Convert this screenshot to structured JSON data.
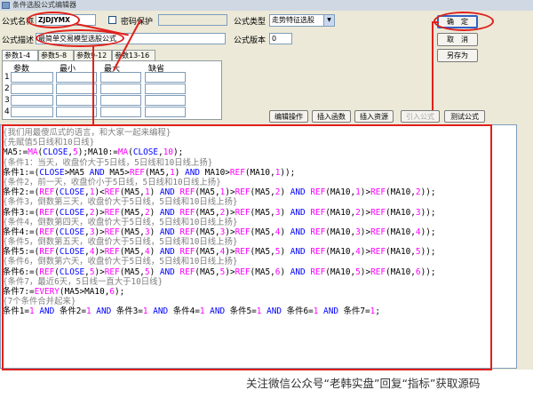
{
  "title_bar": {
    "title": "条件选股公式编辑器"
  },
  "form": {
    "name_label": "公式名称",
    "name_value": "ZJDJYMX",
    "password_label": "密码保护",
    "type_label": "公式类型",
    "type_value": "走势特征选股",
    "desc_label": "公式描述",
    "desc_value": "最简单交易模型选股公式",
    "version_label": "公式版本",
    "version_value": "0"
  },
  "buttons": {
    "ok": "确　定",
    "cancel": "取　消",
    "save_as": "另存为",
    "edit_ops": "编辑操作",
    "insert_func": "插入函数",
    "insert_res": "插入资源",
    "import": "引入公式",
    "test": "测试公式"
  },
  "param_tabs": [
    "参数1-4",
    "参数5-8",
    "参数9-12",
    "参数13-16"
  ],
  "param_table": {
    "headers": [
      "参数",
      "最小",
      "最大",
      "缺省"
    ],
    "rows": [
      "1",
      "2",
      "3",
      "4"
    ]
  },
  "code_lines": [
    [
      [
        "cm",
        "{我们用最傻瓜式的语言，和大家一起来编程}"
      ]
    ],
    [
      [
        "cm",
        "{先赋值5日线和10日线}"
      ]
    ],
    [
      [
        "t",
        "MA5:="
      ],
      [
        "fn",
        "MA"
      ],
      [
        "t",
        "("
      ],
      [
        "kw",
        "CLOSE"
      ],
      [
        "t",
        ","
      ],
      [
        "num",
        "5"
      ],
      [
        "t",
        ");MA10:="
      ],
      [
        "fn",
        "MA"
      ],
      [
        "t",
        "("
      ],
      [
        "kw",
        "CLOSE"
      ],
      [
        "t",
        ","
      ],
      [
        "num",
        "10"
      ],
      [
        "t",
        ");"
      ]
    ],
    [
      [
        "cm",
        "{条件1：当天，收盘价大于5日线，5日线和10日线上扬}"
      ]
    ],
    [
      [
        "t",
        "条件1:=("
      ],
      [
        "kw",
        "CLOSE"
      ],
      [
        "t",
        ">MA5 "
      ],
      [
        "kw",
        "AND"
      ],
      [
        "t",
        " MA5>"
      ],
      [
        "fn",
        "REF"
      ],
      [
        "t",
        "(MA5,"
      ],
      [
        "num",
        "1"
      ],
      [
        "t",
        ") "
      ],
      [
        "kw",
        "AND"
      ],
      [
        "t",
        " MA10>"
      ],
      [
        "fn",
        "REF"
      ],
      [
        "t",
        "(MA10,"
      ],
      [
        "num",
        "1"
      ],
      [
        "t",
        "));"
      ]
    ],
    [
      [
        "cm",
        "{条件2，前一天，收盘价小于5日线，5日线和10日线上扬}"
      ]
    ],
    [
      [
        "t",
        "条件2:=("
      ],
      [
        "fn",
        "REF"
      ],
      [
        "t",
        "("
      ],
      [
        "kw",
        "CLOSE"
      ],
      [
        "t",
        ","
      ],
      [
        "num",
        "1"
      ],
      [
        "t",
        ")<"
      ],
      [
        "fn",
        "REF"
      ],
      [
        "t",
        "(MA5,"
      ],
      [
        "num",
        "1"
      ],
      [
        "t",
        ") "
      ],
      [
        "kw",
        "AND"
      ],
      [
        "t",
        " "
      ],
      [
        "fn",
        "REF"
      ],
      [
        "t",
        "(MA5,"
      ],
      [
        "num",
        "1"
      ],
      [
        "t",
        ")>"
      ],
      [
        "fn",
        "REF"
      ],
      [
        "t",
        "(MA5,"
      ],
      [
        "num",
        "2"
      ],
      [
        "t",
        ") "
      ],
      [
        "kw",
        "AND"
      ],
      [
        "t",
        " "
      ],
      [
        "fn",
        "REF"
      ],
      [
        "t",
        "(MA10,"
      ],
      [
        "num",
        "1"
      ],
      [
        "t",
        ")>"
      ],
      [
        "fn",
        "REF"
      ],
      [
        "t",
        "(MA10,"
      ],
      [
        "num",
        "2"
      ],
      [
        "t",
        "));"
      ]
    ],
    [
      [
        "cm",
        "{条件3，倒数第三天，收盘价大于5日线，5日线和10日线上扬}"
      ]
    ],
    [
      [
        "t",
        "条件3:=("
      ],
      [
        "fn",
        "REF"
      ],
      [
        "t",
        "("
      ],
      [
        "kw",
        "CLOSE"
      ],
      [
        "t",
        ","
      ],
      [
        "num",
        "2"
      ],
      [
        "t",
        ")>"
      ],
      [
        "fn",
        "REF"
      ],
      [
        "t",
        "(MA5,"
      ],
      [
        "num",
        "2"
      ],
      [
        "t",
        ") "
      ],
      [
        "kw",
        "AND"
      ],
      [
        "t",
        " "
      ],
      [
        "fn",
        "REF"
      ],
      [
        "t",
        "(MA5,"
      ],
      [
        "num",
        "2"
      ],
      [
        "t",
        ")>"
      ],
      [
        "fn",
        "REF"
      ],
      [
        "t",
        "(MA5,"
      ],
      [
        "num",
        "3"
      ],
      [
        "t",
        ") "
      ],
      [
        "kw",
        "AND"
      ],
      [
        "t",
        " "
      ],
      [
        "fn",
        "REF"
      ],
      [
        "t",
        "(MA10,"
      ],
      [
        "num",
        "2"
      ],
      [
        "t",
        ")>"
      ],
      [
        "fn",
        "REF"
      ],
      [
        "t",
        "(MA10,"
      ],
      [
        "num",
        "3"
      ],
      [
        "t",
        "));"
      ]
    ],
    [
      [
        "cm",
        "{条件4，倒数第四天，收盘价大于5日线，5日线和10日线上扬}"
      ]
    ],
    [
      [
        "t",
        "条件4:=("
      ],
      [
        "fn",
        "REF"
      ],
      [
        "t",
        "("
      ],
      [
        "kw",
        "CLOSE"
      ],
      [
        "t",
        ","
      ],
      [
        "num",
        "3"
      ],
      [
        "t",
        ")>"
      ],
      [
        "fn",
        "REF"
      ],
      [
        "t",
        "(MA5,"
      ],
      [
        "num",
        "3"
      ],
      [
        "t",
        ") "
      ],
      [
        "kw",
        "AND"
      ],
      [
        "t",
        " "
      ],
      [
        "fn",
        "REF"
      ],
      [
        "t",
        "(MA5,"
      ],
      [
        "num",
        "3"
      ],
      [
        "t",
        ")>"
      ],
      [
        "fn",
        "REF"
      ],
      [
        "t",
        "(MA5,"
      ],
      [
        "num",
        "4"
      ],
      [
        "t",
        ") "
      ],
      [
        "kw",
        "AND"
      ],
      [
        "t",
        " "
      ],
      [
        "fn",
        "REF"
      ],
      [
        "t",
        "(MA10,"
      ],
      [
        "num",
        "3"
      ],
      [
        "t",
        ")>"
      ],
      [
        "fn",
        "REF"
      ],
      [
        "t",
        "(MA10,"
      ],
      [
        "num",
        "4"
      ],
      [
        "t",
        "));"
      ]
    ],
    [
      [
        "cm",
        "{条件5，倒数第五天，收盘价大于5日线，5日线和10日线上扬}"
      ]
    ],
    [
      [
        "t",
        "条件5:=("
      ],
      [
        "fn",
        "REF"
      ],
      [
        "t",
        "("
      ],
      [
        "kw",
        "CLOSE"
      ],
      [
        "t",
        ","
      ],
      [
        "num",
        "4"
      ],
      [
        "t",
        ")>"
      ],
      [
        "fn",
        "REF"
      ],
      [
        "t",
        "(MA5,"
      ],
      [
        "num",
        "4"
      ],
      [
        "t",
        ") "
      ],
      [
        "kw",
        "AND"
      ],
      [
        "t",
        " "
      ],
      [
        "fn",
        "REF"
      ],
      [
        "t",
        "(MA5,"
      ],
      [
        "num",
        "4"
      ],
      [
        "t",
        ")>"
      ],
      [
        "fn",
        "REF"
      ],
      [
        "t",
        "(MA5,"
      ],
      [
        "num",
        "5"
      ],
      [
        "t",
        ") "
      ],
      [
        "kw",
        "AND"
      ],
      [
        "t",
        " "
      ],
      [
        "fn",
        "REF"
      ],
      [
        "t",
        "(MA10,"
      ],
      [
        "num",
        "4"
      ],
      [
        "t",
        ")>"
      ],
      [
        "fn",
        "REF"
      ],
      [
        "t",
        "(MA10,"
      ],
      [
        "num",
        "5"
      ],
      [
        "t",
        "));"
      ]
    ],
    [
      [
        "cm",
        "{条件6，倒数第六天，收盘价大于5日线，5日线和10日线上扬}"
      ]
    ],
    [
      [
        "t",
        "条件6:=("
      ],
      [
        "fn",
        "REF"
      ],
      [
        "t",
        "("
      ],
      [
        "kw",
        "CLOSE"
      ],
      [
        "t",
        ","
      ],
      [
        "num",
        "5"
      ],
      [
        "t",
        ")>"
      ],
      [
        "fn",
        "REF"
      ],
      [
        "t",
        "(MA5,"
      ],
      [
        "num",
        "5"
      ],
      [
        "t",
        ") "
      ],
      [
        "kw",
        "AND"
      ],
      [
        "t",
        " "
      ],
      [
        "fn",
        "REF"
      ],
      [
        "t",
        "(MA5,"
      ],
      [
        "num",
        "5"
      ],
      [
        "t",
        ")>"
      ],
      [
        "fn",
        "REF"
      ],
      [
        "t",
        "(MA5,"
      ],
      [
        "num",
        "6"
      ],
      [
        "t",
        ") "
      ],
      [
        "kw",
        "AND"
      ],
      [
        "t",
        " "
      ],
      [
        "fn",
        "REF"
      ],
      [
        "t",
        "(MA10,"
      ],
      [
        "num",
        "5"
      ],
      [
        "t",
        ")>"
      ],
      [
        "fn",
        "REF"
      ],
      [
        "t",
        "(MA10,"
      ],
      [
        "num",
        "6"
      ],
      [
        "t",
        "));"
      ]
    ],
    [
      [
        "cm",
        "{条件7，最近6天，5日线一直大于10日线}"
      ]
    ],
    [
      [
        "t",
        "条件7:="
      ],
      [
        "fn",
        "EVERY"
      ],
      [
        "t",
        "(MA5>MA10,"
      ],
      [
        "num",
        "6"
      ],
      [
        "t",
        ");"
      ]
    ],
    [
      [
        "cm",
        "{7个条件合并起来}"
      ]
    ],
    [
      [
        "t",
        "条件1="
      ],
      [
        "num",
        "1"
      ],
      [
        "t",
        " "
      ],
      [
        "kw",
        "AND"
      ],
      [
        "t",
        " 条件2="
      ],
      [
        "num",
        "1"
      ],
      [
        "t",
        " "
      ],
      [
        "kw",
        "AND"
      ],
      [
        "t",
        " 条件3="
      ],
      [
        "num",
        "1"
      ],
      [
        "t",
        " "
      ],
      [
        "kw",
        "AND"
      ],
      [
        "t",
        " 条件4="
      ],
      [
        "num",
        "1"
      ],
      [
        "t",
        " "
      ],
      [
        "kw",
        "AND"
      ],
      [
        "t",
        " 条件5="
      ],
      [
        "num",
        "1"
      ],
      [
        "t",
        " "
      ],
      [
        "kw",
        "AND"
      ],
      [
        "t",
        " 条件6="
      ],
      [
        "num",
        "1"
      ],
      [
        "t",
        " "
      ],
      [
        "kw",
        "AND"
      ],
      [
        "t",
        " 条件7="
      ],
      [
        "num",
        "1"
      ],
      [
        "t",
        ";"
      ]
    ]
  ],
  "footer": {
    "text": "关注微信公众号“老韩实盘”回复“指标”获取源码"
  },
  "colors": {
    "keyword": "#0000ff",
    "number": "#ff00ff",
    "comment": "#808080",
    "annotation": "#e0201c"
  }
}
